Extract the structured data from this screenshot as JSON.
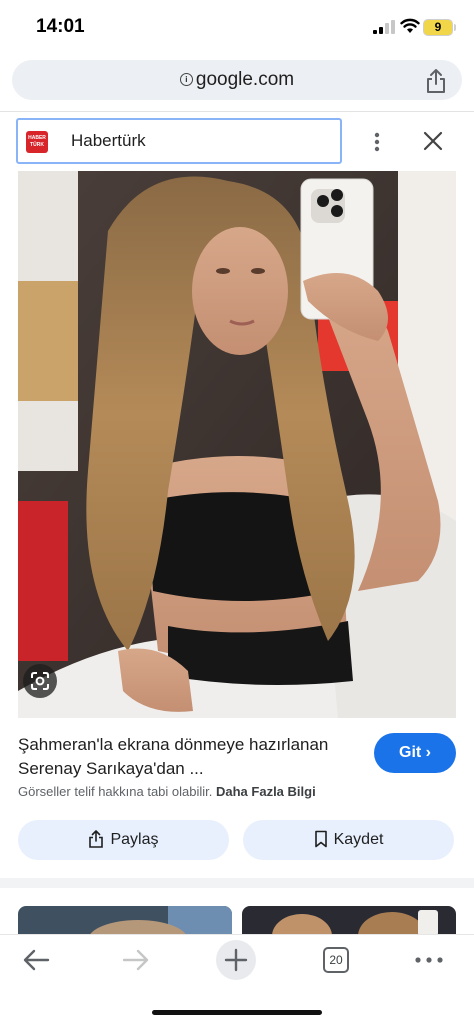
{
  "status": {
    "time": "14:01",
    "battery": "9"
  },
  "browser": {
    "url": "google.com",
    "share_icon": "share-icon",
    "source_name": "Habertürk",
    "source_logo_text": "HABER TÜRK"
  },
  "result": {
    "title": "Şahmeran'la ekrana dönmeye hazırlanan Serenay Sarıkaya'dan ...",
    "go_label": "Git",
    "copyright_text": "Görseller telif hakkına tabi olabilir.",
    "more_info_label": "Daha Fazla Bilgi",
    "share_label": "Paylaş",
    "save_label": "Kaydet"
  },
  "toolbar": {
    "tab_count": "20"
  },
  "colors": {
    "accent": "#1a73e8",
    "pill_bg": "#e8f0fe",
    "source_red": "#d7252a"
  }
}
